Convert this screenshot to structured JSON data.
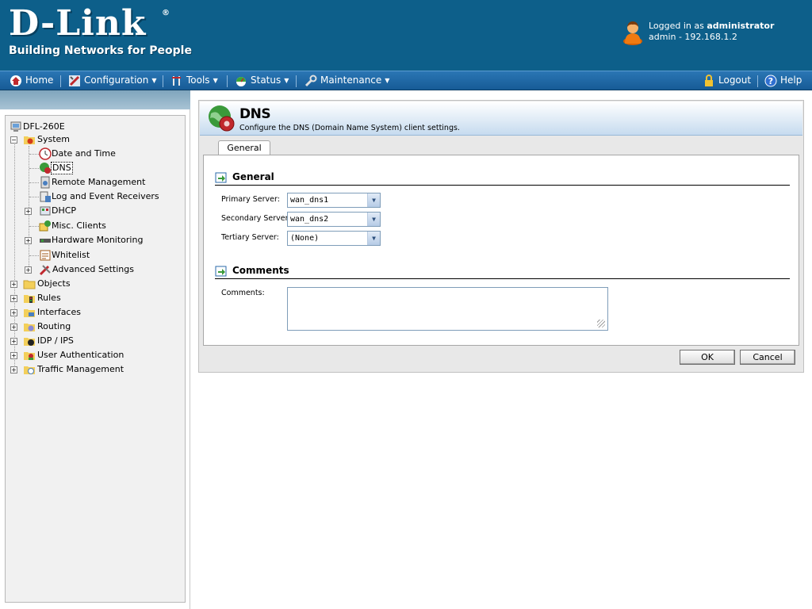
{
  "header": {
    "brand": "D-Link",
    "registered": "®",
    "tagline": "Building Networks for People",
    "login_prefix": "Logged in as",
    "login_user": "administrator",
    "login_detail": "admin - 192.168.1.2"
  },
  "menu": {
    "home": "Home",
    "configuration": "Configuration",
    "tools": "Tools",
    "status": "Status",
    "maintenance": "Maintenance",
    "logout": "Logout",
    "help": "Help"
  },
  "tree": {
    "root": "DFL-260E",
    "system": "System",
    "date_time": "Date and Time",
    "dns": "DNS",
    "remote_management": "Remote Management",
    "log_event": "Log and Event Receivers",
    "dhcp": "DHCP",
    "misc_clients": "Misc. Clients",
    "hardware_monitoring": "Hardware Monitoring",
    "whitelist": "Whitelist",
    "advanced_settings": "Advanced Settings",
    "objects": "Objects",
    "rules": "Rules",
    "interfaces": "Interfaces",
    "routing": "Routing",
    "idp_ips": "IDP / IPS",
    "user_auth": "User Authentication",
    "traffic_mgmt": "Traffic Management",
    "expand_symbol": "+",
    "collapse_symbol": "−"
  },
  "page": {
    "title": "DNS",
    "description": "Configure the DNS (Domain Name System) client settings.",
    "tab": "General",
    "section_general": "General",
    "primary_label": "Primary Server:",
    "primary_value": "wan_dns1",
    "secondary_label": "Secondary Server:",
    "secondary_value": "wan_dns2",
    "tertiary_label": "Tertiary Server:",
    "tertiary_value": "(None)",
    "section_comments": "Comments",
    "comments_label": "Comments:",
    "comments_value": "",
    "ok": "OK",
    "cancel": "Cancel"
  },
  "colors": {
    "header_bg": "#0d5f8a",
    "menubar": "#1f68a6",
    "title_gradient_end": "#c6dbef"
  }
}
